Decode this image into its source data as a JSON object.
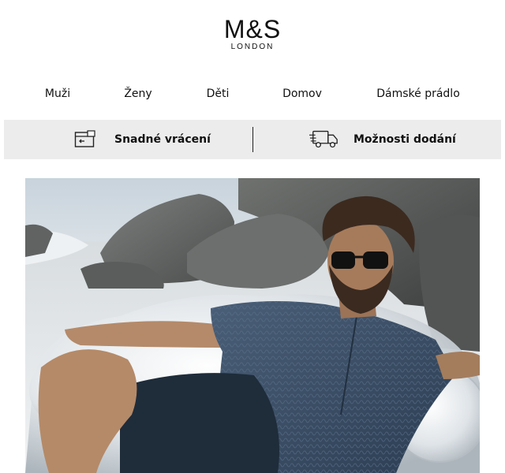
{
  "brand": {
    "name": "M&S",
    "subtitle": "LONDON"
  },
  "nav": {
    "items": [
      {
        "label": "Muži"
      },
      {
        "label": "Ženy"
      },
      {
        "label": "Děti"
      },
      {
        "label": "Domov"
      },
      {
        "label": "Dámské prádlo"
      }
    ]
  },
  "services": {
    "returns": {
      "label": "Snadné vrácení",
      "icon": "return-box-icon"
    },
    "delivery": {
      "label": "Možnosti dodání",
      "icon": "delivery-truck-icon"
    }
  },
  "hero": {
    "icon": "hero-photo-man-beach"
  }
}
